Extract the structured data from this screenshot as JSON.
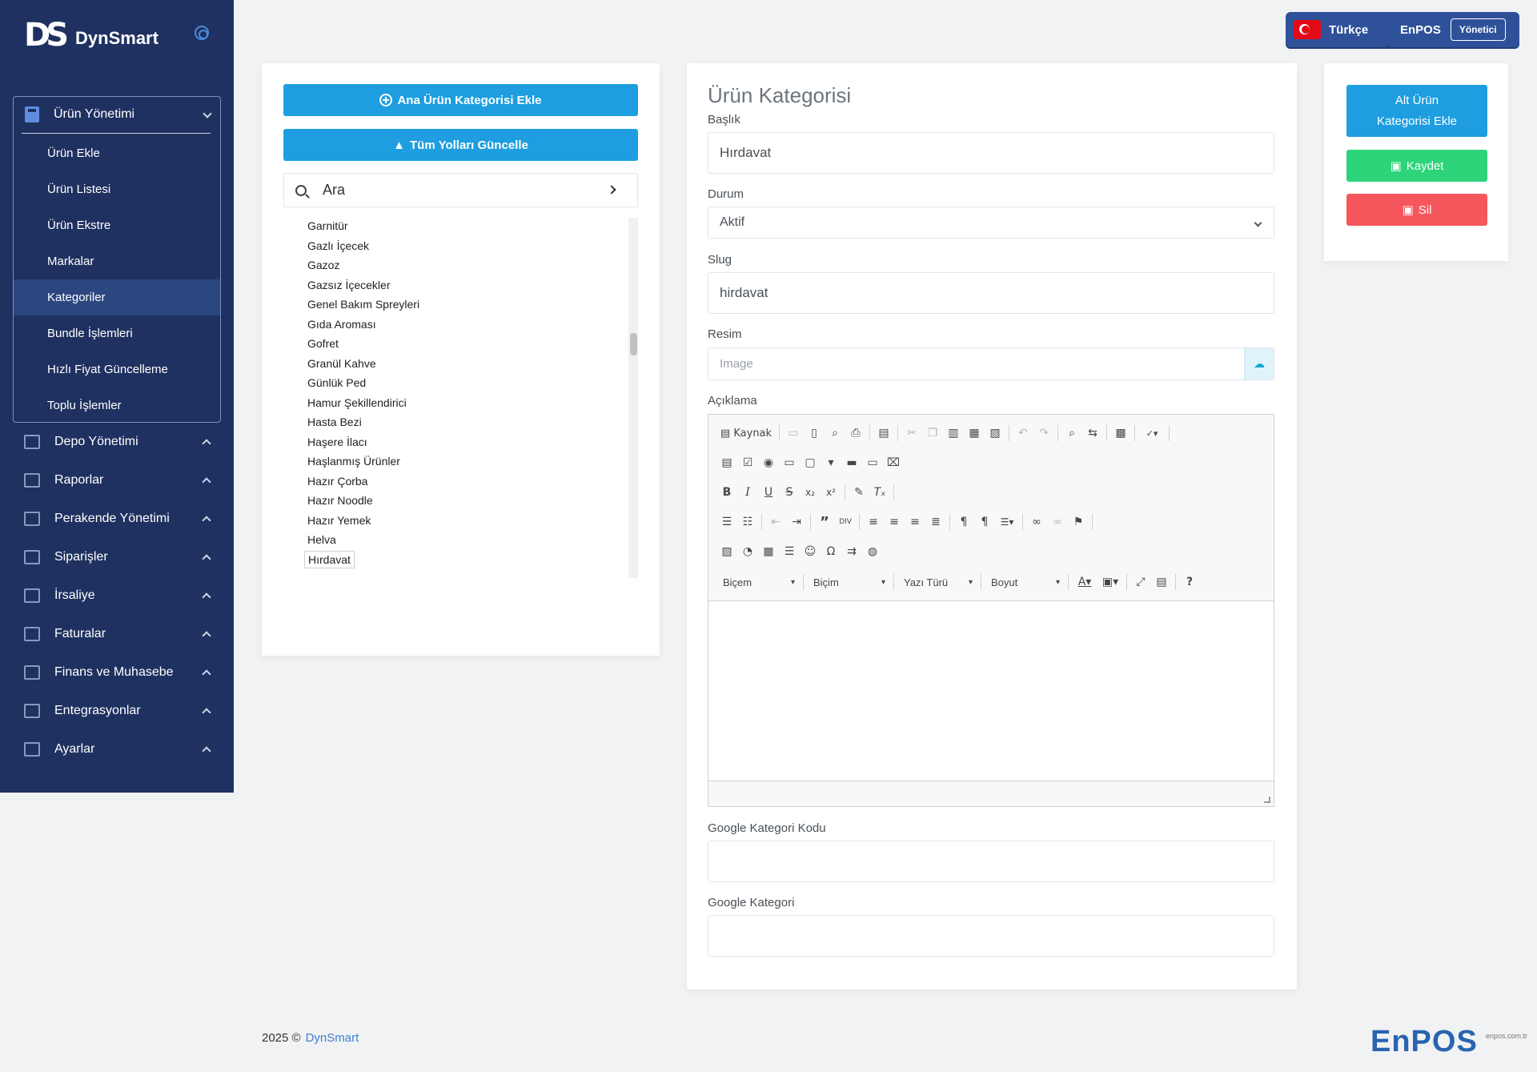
{
  "brand": {
    "mark": "DS",
    "name": "DynSmart"
  },
  "sidebar": {
    "group_title": "Ürün Yönetimi",
    "sub_items": [
      {
        "label": "Ürün Ekle"
      },
      {
        "label": "Ürün Listesi"
      },
      {
        "label": "Ürün Ekstre"
      },
      {
        "label": "Markalar"
      },
      {
        "label": "Kategoriler",
        "active": true
      },
      {
        "label": "Bundle İşlemleri"
      },
      {
        "label": "Hızlı Fiyat Güncelleme"
      },
      {
        "label": "Toplu İşlemler"
      }
    ],
    "items": [
      {
        "label": "Depo Yönetimi",
        "icon": "cart-icon"
      },
      {
        "label": "Raporlar",
        "icon": "map-icon"
      },
      {
        "label": "Perakende Yönetimi",
        "icon": "map-icon"
      },
      {
        "label": "Siparişler",
        "icon": "truck-icon"
      },
      {
        "label": "İrsaliye",
        "icon": "cart-icon"
      },
      {
        "label": "Faturalar",
        "icon": "document-icon"
      },
      {
        "label": "Finans ve Muhasebe",
        "icon": "calculator-icon"
      },
      {
        "label": "Entegrasyonlar",
        "icon": "map-icon"
      },
      {
        "label": "Ayarlar",
        "icon": "folder-icon"
      }
    ]
  },
  "header": {
    "language": "Türkçe",
    "user": "EnPOS",
    "role": "Yönetici"
  },
  "tree_panel": {
    "add_main_button": "Ana Ürün Kategorisi Ekle",
    "update_paths_button": "Tüm Yolları Güncelle",
    "search_placeholder": "Ara",
    "items": [
      "Garnitür",
      "Gazlı İçecek",
      "Gazoz",
      "Gazsız İçecekler",
      "Genel Bakım Spreyleri",
      "Gıda Aroması",
      "Gofret",
      "Granül Kahve",
      "Günlük Ped",
      "Hamur Şekillendirici",
      "Hasta Bezi",
      "Haşere İlacı",
      "Haşlanmış Ürünler",
      "Hazır Çorba",
      "Hazır Noodle",
      "Hazır Yemek",
      "Helva",
      "Hırdavat"
    ],
    "selected": "Hırdavat"
  },
  "form": {
    "title": "Ürün Kategorisi",
    "title_label": "Başlık",
    "title_value": "Hırdavat",
    "status_label": "Durum",
    "status_value": "Aktif",
    "slug_label": "Slug",
    "slug_value": "hirdavat",
    "image_label": "Resim",
    "image_placeholder": "Image",
    "description_label": "Açıklama",
    "editor": {
      "source_label": "Kaynak",
      "combo_format": "Biçem",
      "combo_style": "Biçim",
      "combo_font": "Yazı Türü",
      "combo_size": "Boyut"
    },
    "google_code_label": "Google Kategori Kodu",
    "google_code_value": "",
    "google_category_label": "Google Kategori",
    "google_category_value": ""
  },
  "actions": {
    "add_sub": "Alt Ürün Kategorisi Ekle",
    "save": "Kaydet",
    "delete": "Sil"
  },
  "footer": {
    "year": "2025 ©",
    "link": "DynSmart"
  },
  "footer_logo": {
    "name": "EnPOS",
    "domain": "enpos.com.tr"
  },
  "colors": {
    "sidebar": "#1f3160",
    "primary": "#1e9ee0",
    "success": "#2ed47a",
    "danger": "#f5575c",
    "header_btn": "#2f5199"
  }
}
